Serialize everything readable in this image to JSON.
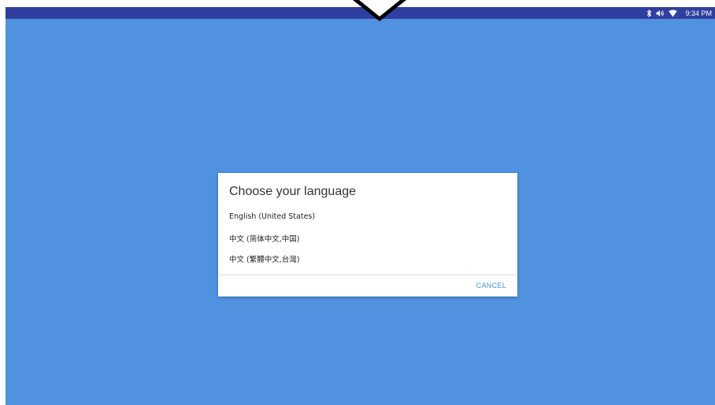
{
  "status_bar": {
    "time": "9:34 PM",
    "icons": [
      "bluetooth-icon",
      "volume-icon",
      "wifi-icon"
    ],
    "background": "#303f9f"
  },
  "screen": {
    "background": "#5091e0"
  },
  "dialog": {
    "title": "Choose your language",
    "options": [
      "English (United States)",
      "中文 (简体中文,中国)",
      "中文 (繁體中文,台灣)"
    ],
    "cancel_label": "CANCEL",
    "accent": "#4a90d9"
  },
  "overlay": {
    "icon": "down-arrow-icon"
  }
}
